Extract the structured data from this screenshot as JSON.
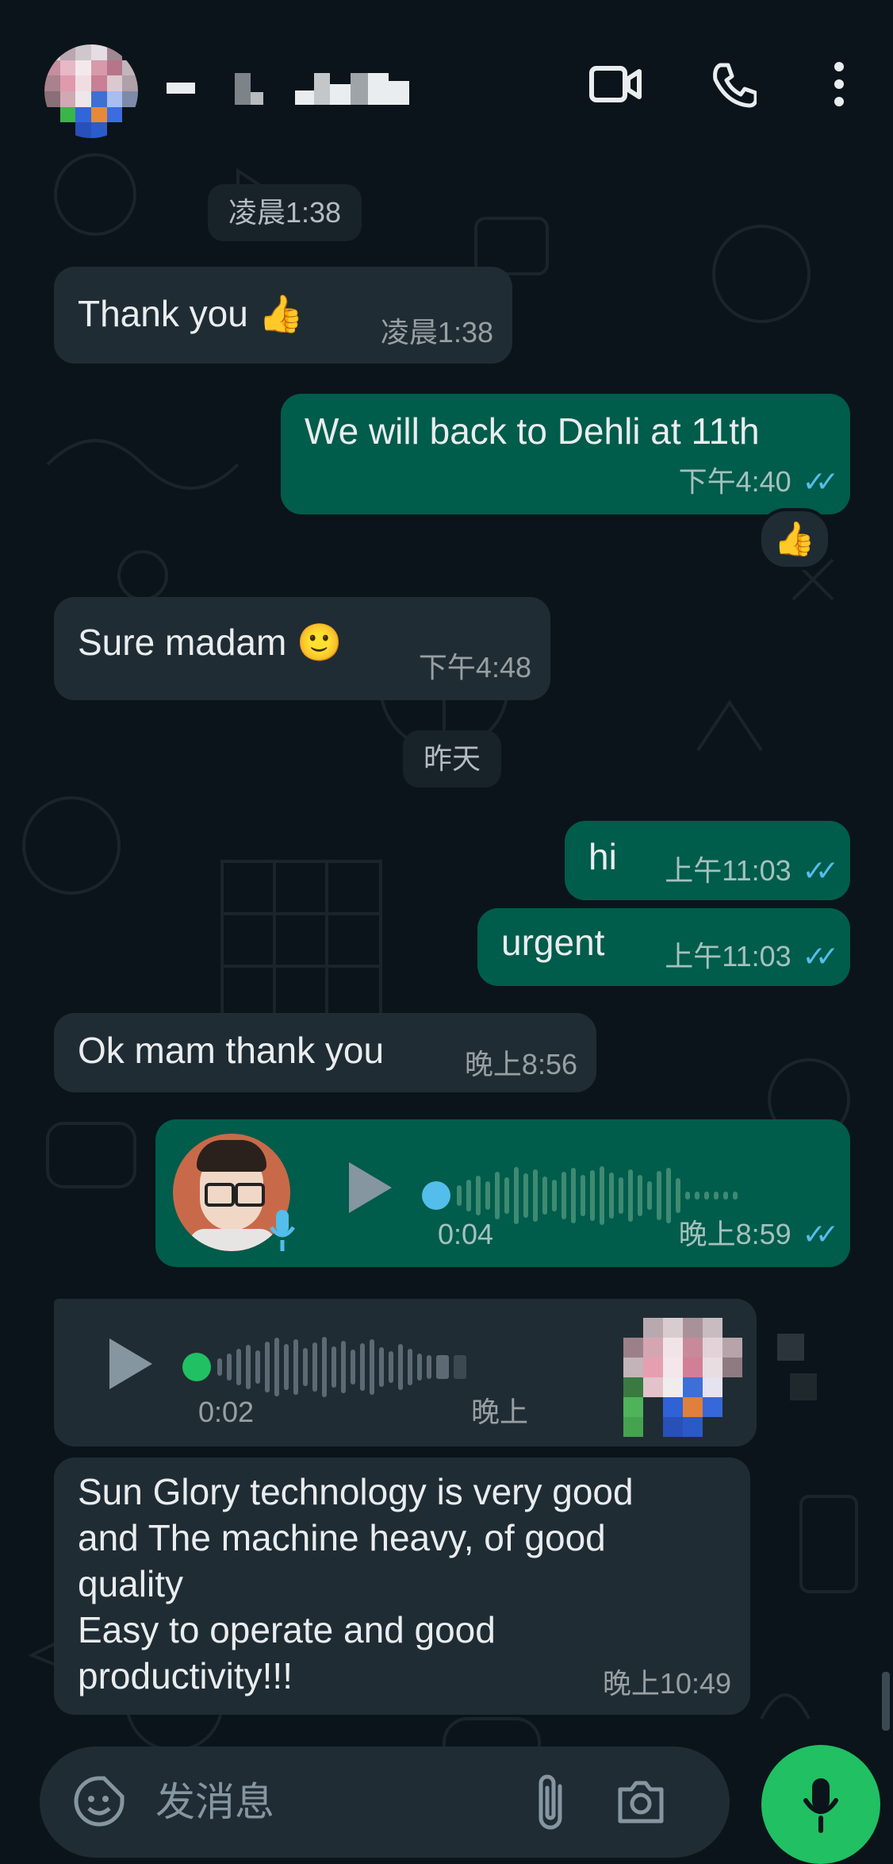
{
  "header": {
    "contact_name": "",
    "icons": [
      "video-call-icon",
      "phone-icon",
      "more-options-icon"
    ]
  },
  "messages": [
    {
      "type": "date",
      "text": "凌晨1:38"
    },
    {
      "type": "incoming",
      "text": "Thank you 👍",
      "time": "凌晨1:38"
    },
    {
      "type": "outgoing",
      "text": "We will back to Dehli at 11th",
      "time": "下午4:40",
      "reaction": "👍"
    },
    {
      "type": "incoming",
      "text": "Sure madam 🙂",
      "time": "下午4:48"
    },
    {
      "type": "date",
      "text": "昨天"
    },
    {
      "type": "outgoing",
      "text": "hi",
      "time": "上午11:03"
    },
    {
      "type": "outgoing",
      "text": "urgent",
      "time": "上午11:03"
    },
    {
      "type": "incoming",
      "text": "Ok mam thank you",
      "time": "晚上8:56"
    },
    {
      "type": "outgoing-voice",
      "duration": "0:04",
      "time": "晚上8:59"
    },
    {
      "type": "incoming-voice",
      "duration": "0:02",
      "time": "晚上"
    },
    {
      "type": "incoming",
      "lines": [
        "Sun Glory technology is very good",
        "and  The machine  heavy, of good",
        "quality",
        "Easy to operate and good",
        "productivity!!!"
      ],
      "time": "晚上10:49"
    }
  ],
  "input": {
    "placeholder": "发消息"
  },
  "colors": {
    "background": "#0b141a",
    "incoming_bubble": "#202c33",
    "outgoing_bubble": "#005c4b",
    "read_ticks": "#53bdeb",
    "mic_button": "#21c063"
  }
}
